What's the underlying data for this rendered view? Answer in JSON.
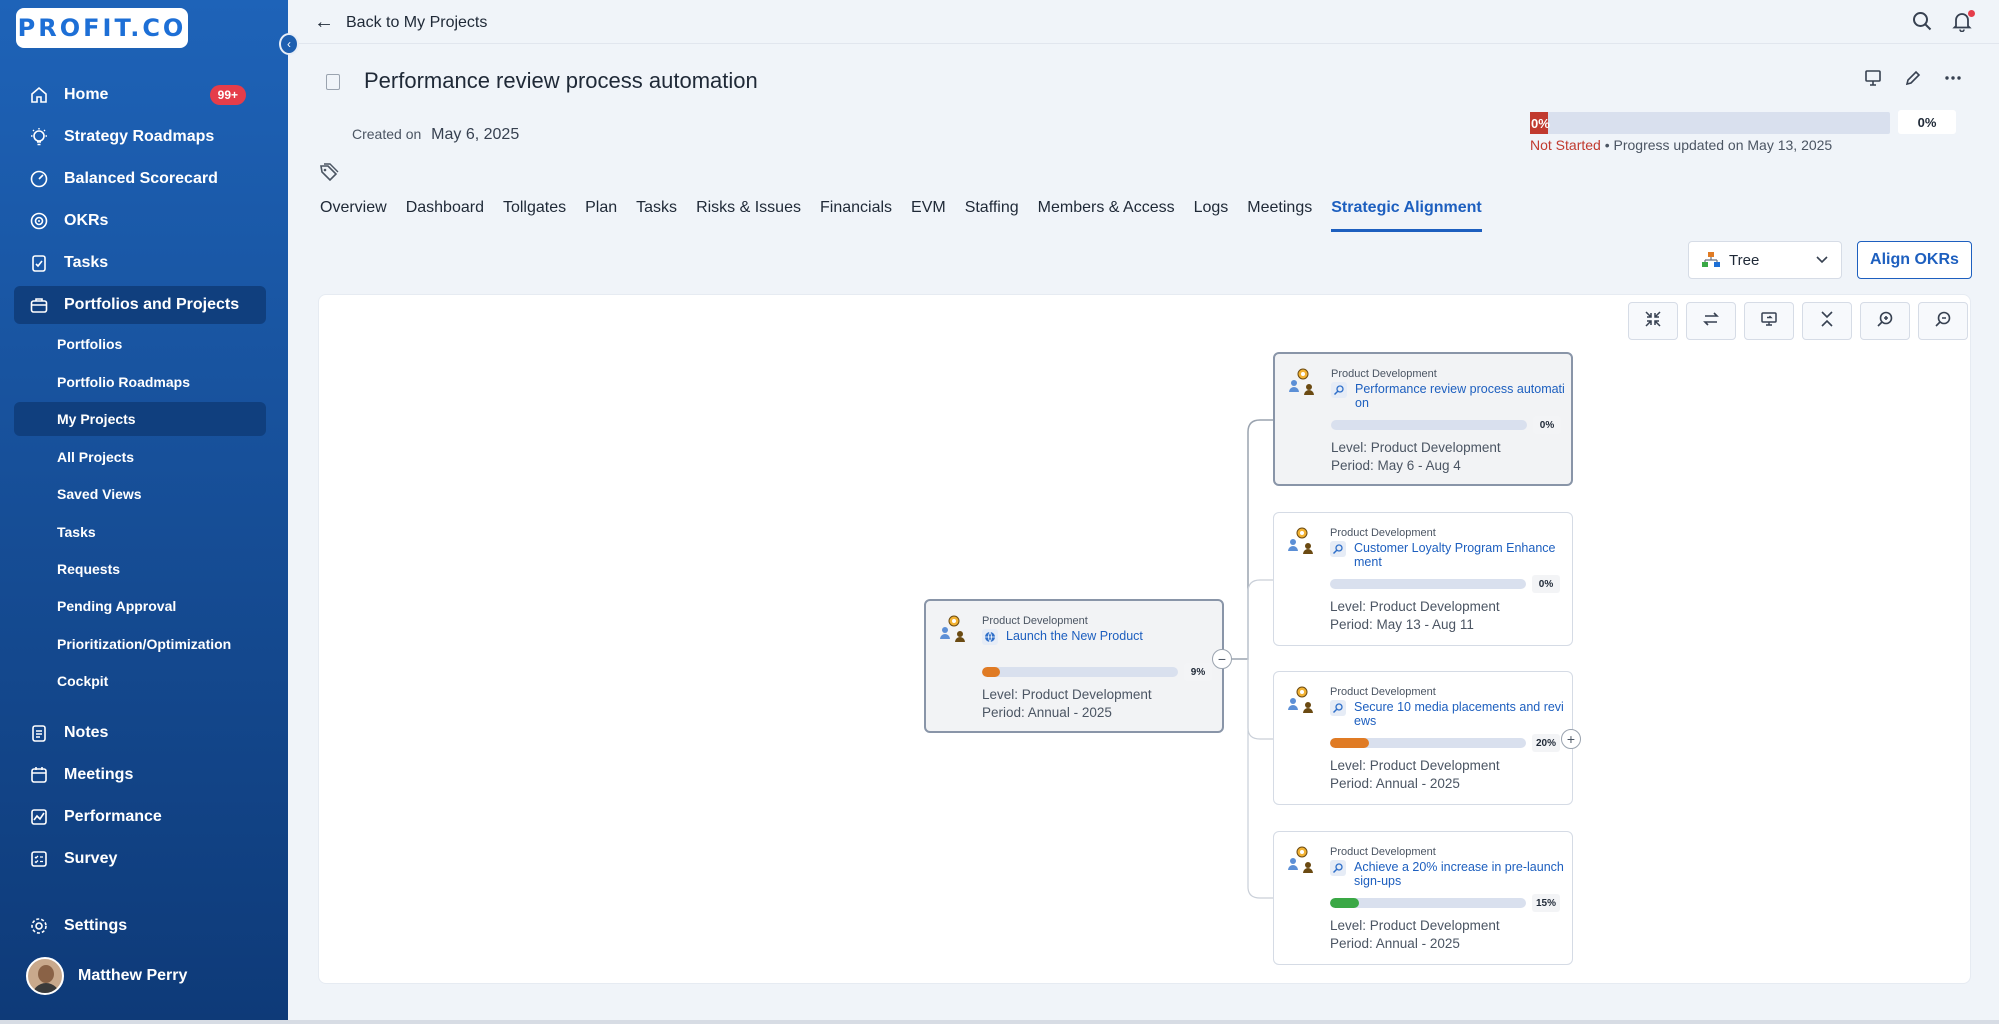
{
  "brand": {
    "logo": "PROFIT.CO",
    "accent": "#1d5fbf",
    "sidebar": "#17509a",
    "danger": "#c13a2f"
  },
  "sidebar": {
    "items": [
      {
        "label": "Home",
        "icon": "home-icon",
        "badge": "99+"
      },
      {
        "label": "Strategy Roadmaps",
        "icon": "bulb-icon"
      },
      {
        "label": "Balanced Scorecard",
        "icon": "gauge-icon"
      },
      {
        "label": "OKRs",
        "icon": "target-icon"
      },
      {
        "label": "Tasks",
        "icon": "clipboard-icon"
      },
      {
        "label": "Portfolios and Projects",
        "icon": "briefcase-icon"
      }
    ],
    "subitems": [
      {
        "label": "Portfolios"
      },
      {
        "label": "Portfolio Roadmaps"
      },
      {
        "label": "My Projects"
      },
      {
        "label": "All Projects"
      },
      {
        "label": "Saved Views"
      },
      {
        "label": "Tasks"
      },
      {
        "label": "Requests"
      },
      {
        "label": "Pending Approval"
      },
      {
        "label": "Prioritization/Optimization"
      },
      {
        "label": "Cockpit"
      }
    ],
    "lower_items": [
      {
        "label": "Notes",
        "icon": "notes-icon"
      },
      {
        "label": "Meetings",
        "icon": "calendar-icon"
      },
      {
        "label": "Performance",
        "icon": "chart-icon"
      },
      {
        "label": "Survey",
        "icon": "survey-icon"
      }
    ],
    "settings": {
      "label": "Settings",
      "icon": "gear-icon"
    },
    "user": {
      "name": "Matthew Perry"
    }
  },
  "topbar": {
    "back_label": "Back to My Projects"
  },
  "header": {
    "title": "Performance review process automation",
    "created_label": "Created on",
    "created_date": "May 6, 2025",
    "progress": {
      "value": 0,
      "bar_label": "0%",
      "pct": "0%",
      "status": "Not Started",
      "updated": "• Progress updated on May 13, 2025"
    }
  },
  "tabs": [
    {
      "label": "Overview"
    },
    {
      "label": "Dashboard"
    },
    {
      "label": "Tollgates"
    },
    {
      "label": "Plan"
    },
    {
      "label": "Tasks"
    },
    {
      "label": "Risks & Issues"
    },
    {
      "label": "Financials"
    },
    {
      "label": "EVM"
    },
    {
      "label": "Staffing"
    },
    {
      "label": "Members & Access"
    },
    {
      "label": "Logs"
    },
    {
      "label": "Meetings"
    },
    {
      "label": "Strategic Alignment",
      "active": true
    }
  ],
  "toolbar": {
    "view_value": "Tree",
    "align_label": "Align OKRs"
  },
  "tree": {
    "root": {
      "category": "Product Development",
      "name": "Launch the New Product",
      "progress": 9,
      "pct": "9%",
      "level": "Level: Product Development",
      "period": "Period: Annual - 2025",
      "bar_color": "#e07b24"
    },
    "children": [
      {
        "category": "Product Development",
        "name": "Performance review process automation",
        "progress": 0,
        "pct": "0%",
        "level": "Level: Product Development",
        "period": "Period: May 6 - Aug 4",
        "bar_color": "#e07b24",
        "highlight": true
      },
      {
        "category": "Product Development",
        "name": "Customer Loyalty Program Enhancement",
        "progress": 0,
        "pct": "0%",
        "level": "Level: Product Development",
        "period": "Period: May 13 - Aug 11",
        "bar_color": "#e07b24"
      },
      {
        "category": "Product Development",
        "name": "Secure 10 media placements and reviews",
        "progress": 20,
        "pct": "20%",
        "level": "Level: Product Development",
        "period": "Period: Annual - 2025",
        "bar_color": "#e07b24"
      },
      {
        "category": "Product Development",
        "name": "Achieve a 20% increase in pre-launch sign-ups",
        "progress": 15,
        "pct": "15%",
        "level": "Level: Product Development",
        "period": "Period: Annual - 2025",
        "bar_color": "#3aa845"
      }
    ]
  }
}
